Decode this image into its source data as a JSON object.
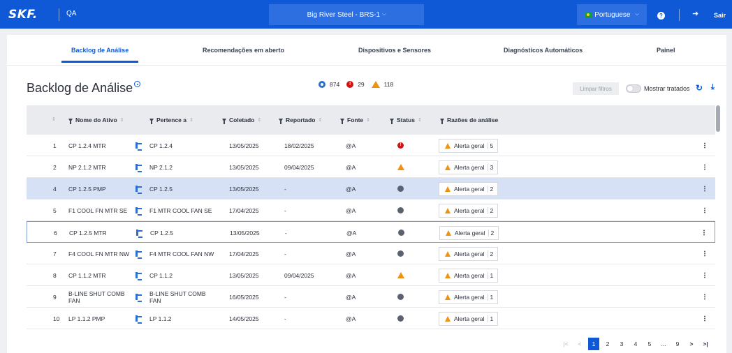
{
  "topbar": {
    "logo": "SKF.",
    "app_name": "QA",
    "site": "Big River Steel - BRS-1",
    "language": "Portuguese",
    "help": "?",
    "logout": "Sair"
  },
  "tabs": [
    {
      "label": "Backlog de Análise",
      "active": true
    },
    {
      "label": "Recomendações em aberto"
    },
    {
      "label": "Dispositivos e Sensores"
    },
    {
      "label": "Diagnósticos Automáticos"
    },
    {
      "label": "Painel"
    }
  ],
  "page": {
    "title": "Backlog de Análise",
    "summary": {
      "total": "874",
      "errors": "29",
      "warnings": "118"
    },
    "clear_filters": "Limpar filtros",
    "show_treated": "Mostrar tratados"
  },
  "table": {
    "columns": [
      "Nome do Ativo",
      "Pertence a",
      "Coletado",
      "Reportado",
      "Fonte",
      "Status",
      "Razões de análise"
    ],
    "rows": [
      {
        "n": "1",
        "asset": "CP 1.2.4 MTR",
        "parent": "CP 1.2.4",
        "collected": "13/05/2025",
        "reported": "18/02/2025",
        "source": "@A",
        "status": "error",
        "reason": "Alerta geral",
        "count": "5"
      },
      {
        "n": "2",
        "asset": "NP 2.1.2 MTR",
        "parent": "NP 2.1.2",
        "collected": "13/05/2025",
        "reported": "09/04/2025",
        "source": "@A",
        "status": "warning",
        "reason": "Alerta geral",
        "count": "3"
      },
      {
        "n": "4",
        "asset": "CP 1.2.5 PMP",
        "parent": "CP 1.2.5",
        "collected": "13/05/2025",
        "reported": "-",
        "source": "@A",
        "status": "none",
        "reason": "Alerta geral",
        "count": "2"
      },
      {
        "n": "5",
        "asset": "F1 COOL FN MTR SE",
        "parent": "F1 MTR COOL FAN SE",
        "collected": "17/04/2025",
        "reported": "-",
        "source": "@A",
        "status": "none",
        "reason": "Alerta geral",
        "count": "2"
      },
      {
        "n": "6",
        "asset": "CP 1.2.5 MTR",
        "parent": "CP 1.2.5",
        "collected": "13/05/2025",
        "reported": "-",
        "source": "@A",
        "status": "none",
        "reason": "Alerta geral",
        "count": "2"
      },
      {
        "n": "7",
        "asset": "F4 COOL FN MTR NW",
        "parent": "F4 MTR COOL FAN NW",
        "collected": "17/04/2025",
        "reported": "-",
        "source": "@A",
        "status": "none",
        "reason": "Alerta geral",
        "count": "2"
      },
      {
        "n": "8",
        "asset": "CP 1.1.2 MTR",
        "parent": "CP 1.1.2",
        "collected": "13/05/2025",
        "reported": "09/04/2025",
        "source": "@A",
        "status": "warning",
        "reason": "Alerta geral",
        "count": "1"
      },
      {
        "n": "9",
        "asset": "B-LINE SHUT COMB FAN",
        "parent": "B-LINE SHUT COMB FAN",
        "collected": "16/05/2025",
        "reported": "-",
        "source": "@A",
        "status": "none",
        "reason": "Alerta geral",
        "count": "1"
      },
      {
        "n": "10",
        "asset": "LP 1.1.2 PMP",
        "parent": "LP 1.1.2",
        "collected": "14/05/2025",
        "reported": "-",
        "source": "@A",
        "status": "none",
        "reason": "Alerta geral",
        "count": "1"
      }
    ]
  },
  "pagination": {
    "first": "|<",
    "prev": "<",
    "pages": [
      "1",
      "2",
      "3",
      "4",
      "5"
    ],
    "ellipsis": "...",
    "last_page": "9",
    "next": ">",
    "last": ">|",
    "current": "1"
  }
}
